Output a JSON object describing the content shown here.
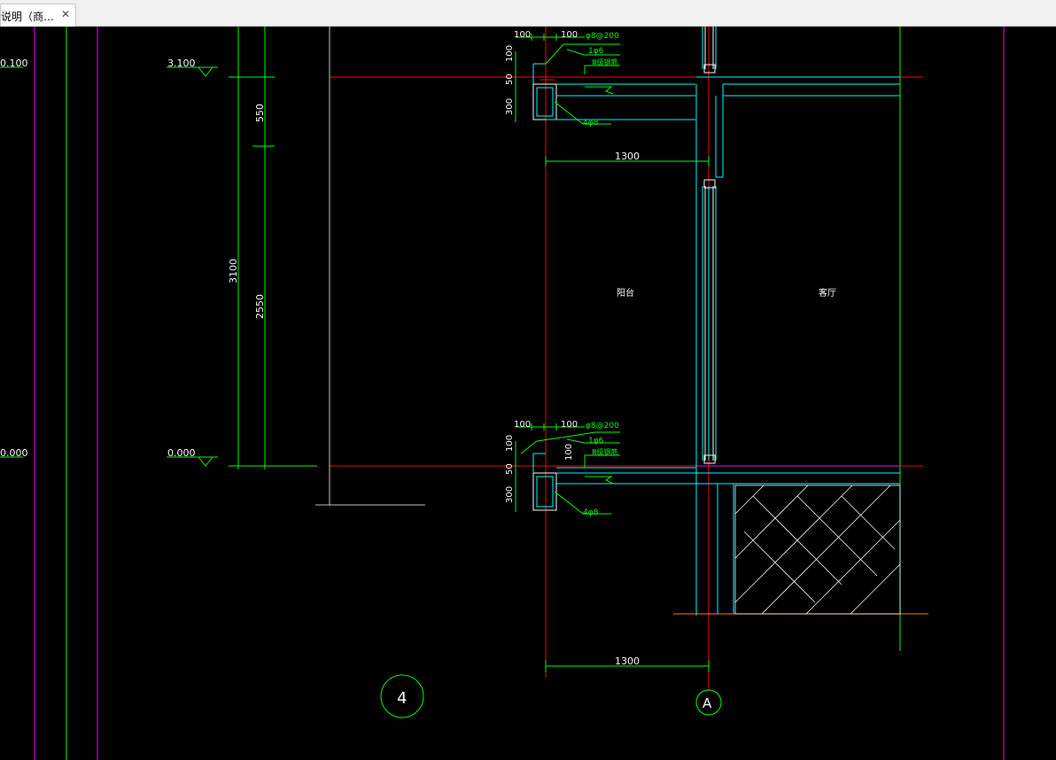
{
  "tab": {
    "title": "说明（商…",
    "close_symbol": "✕"
  },
  "colors": {
    "background": "#000000",
    "green": "#00ff00",
    "red": "#ff0000",
    "cyan": "#00ffff",
    "magenta": "#ff00ff",
    "white": "#ffffff",
    "orange": "#ff8000",
    "grey": "#808080"
  },
  "drawing": {
    "levels": {
      "top": "3.100",
      "bottom": "0.000",
      "cut_top": "0.100",
      "cut_bottom": "0.000"
    },
    "dims": {
      "d550": "550",
      "d2550": "2550",
      "d3100": "3100",
      "w1300_top": "1300",
      "w1300_bot": "1300",
      "d100a": "100",
      "d100b": "100",
      "d100c": "100",
      "d100d": "100",
      "d100e": "100",
      "d100f": "100",
      "d100g": "100",
      "d50a": "50",
      "d50b": "50",
      "d300a": "300",
      "d300b": "300"
    },
    "rebar": {
      "r_a1": "φ8@200",
      "r_b1": "1φ6",
      "r_c1": "Ⅲ级钢筋",
      "r_d1": "4φ8",
      "r_a2": "φ8@200",
      "r_b2": "1φ6",
      "r_c2": "Ⅲ级钢筋",
      "r_d2": "4φ8"
    },
    "rooms": {
      "balcony": "阳台",
      "living": "客厅"
    },
    "axes": {
      "axis4": "4",
      "axisA": "A"
    }
  }
}
